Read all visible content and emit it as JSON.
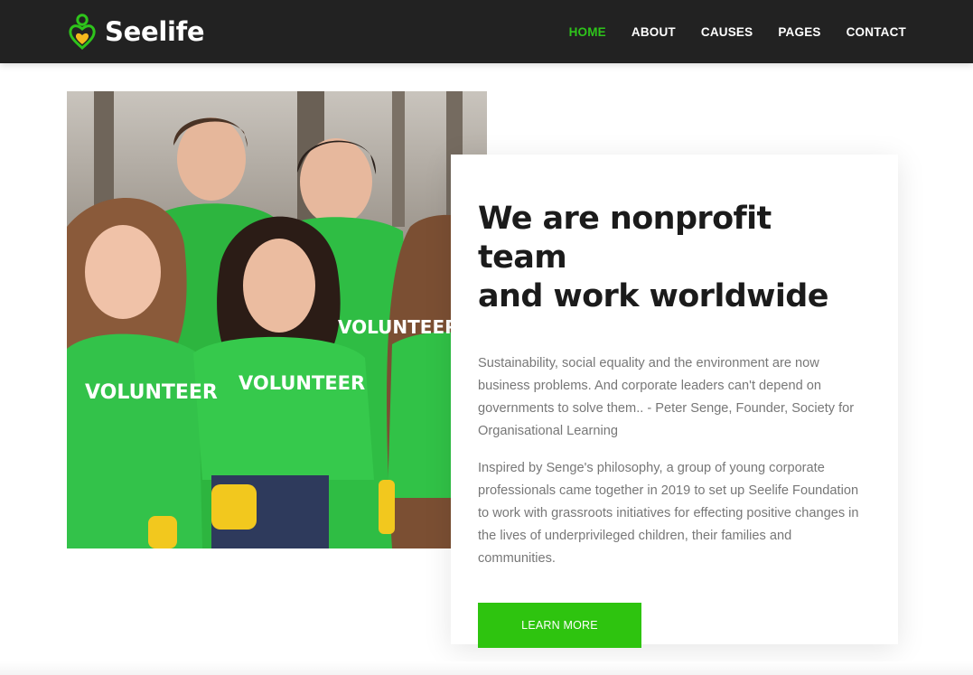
{
  "header": {
    "logo_text": "Seelife",
    "nav": [
      {
        "label": "HOME",
        "active": true
      },
      {
        "label": "ABOUT"
      },
      {
        "label": "CAUSES"
      },
      {
        "label": "PAGES"
      },
      {
        "label": "CONTACT"
      }
    ]
  },
  "hero": {
    "shirt_text": "VOLUNTEER"
  },
  "about": {
    "title_line1": "We are nonprofit team",
    "title_line2": "and work worldwide",
    "paragraph1": "Sustainability, social equality and the environment are now business problems. And corporate leaders can't depend on governments to solve them.. - Peter Senge, Founder, Society for Organisational Learning",
    "paragraph2": "Inspired by Senge's philosophy, a group of young corporate professionals came together in 2019 to set up Seelife Foundation to work with grassroots initiatives for effecting positive changes in the lives of underprivileged children, their families and communities.",
    "button_label": "LEARN MORE"
  },
  "colors": {
    "accent": "#2ec41b",
    "button": "#2ec40f",
    "navbar": "#222222",
    "heading": "#1b1b1b",
    "body_text": "#777777"
  },
  "icons": [
    "heart-person-logo-icon"
  ]
}
